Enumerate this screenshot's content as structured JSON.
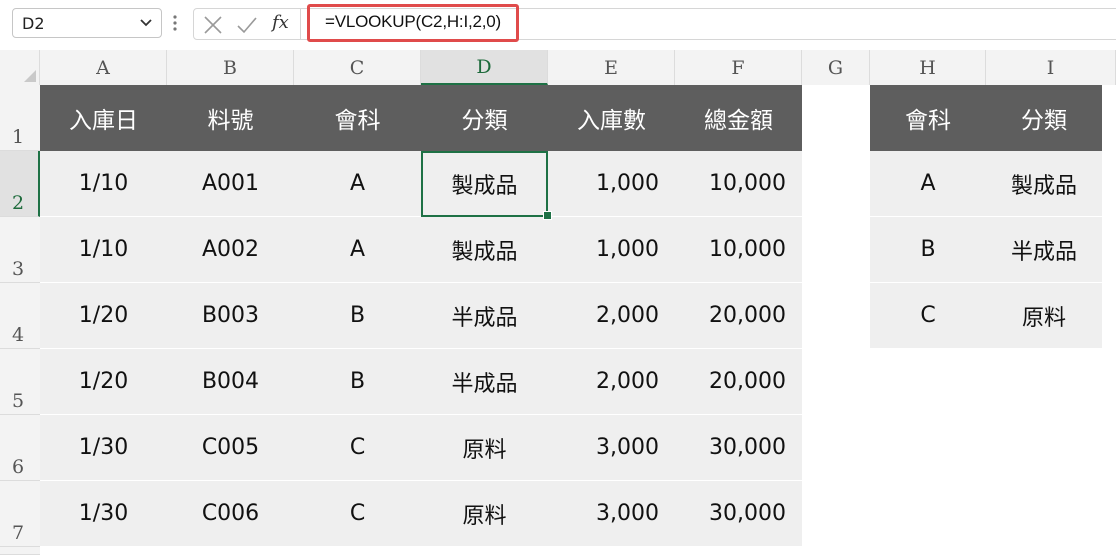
{
  "formula_bar": {
    "name_box": "D2",
    "fx_label": "fx",
    "formula": "=VLOOKUP(C2,H:I,2,0)"
  },
  "columns": [
    "A",
    "B",
    "C",
    "D",
    "E",
    "F",
    "G",
    "H",
    "I"
  ],
  "rows": [
    "1",
    "2",
    "3",
    "4",
    "5",
    "6",
    "7"
  ],
  "table1": {
    "headers": [
      "入庫日",
      "料號",
      "會科",
      "分類",
      "入庫數",
      "總金額"
    ],
    "rows": [
      [
        "1/10",
        "A001",
        "A",
        "製成品",
        "1,000",
        "10,000"
      ],
      [
        "1/10",
        "A002",
        "A",
        "製成品",
        "1,000",
        "10,000"
      ],
      [
        "1/20",
        "B003",
        "B",
        "半成品",
        "2,000",
        "20,000"
      ],
      [
        "1/20",
        "B004",
        "B",
        "半成品",
        "2,000",
        "20,000"
      ],
      [
        "1/30",
        "C005",
        "C",
        "原料",
        "3,000",
        "30,000"
      ],
      [
        "1/30",
        "C006",
        "C",
        "原料",
        "3,000",
        "30,000"
      ]
    ]
  },
  "table2": {
    "headers": [
      "會科",
      "分類"
    ],
    "rows": [
      [
        "A",
        "製成品"
      ],
      [
        "B",
        "半成品"
      ],
      [
        "C",
        "原料"
      ]
    ]
  },
  "colors": {
    "header_fill": "#5e5e5e",
    "body_fill": "#efefef",
    "selection": "#1e7145",
    "formula_highlight": "#e04b4b"
  }
}
